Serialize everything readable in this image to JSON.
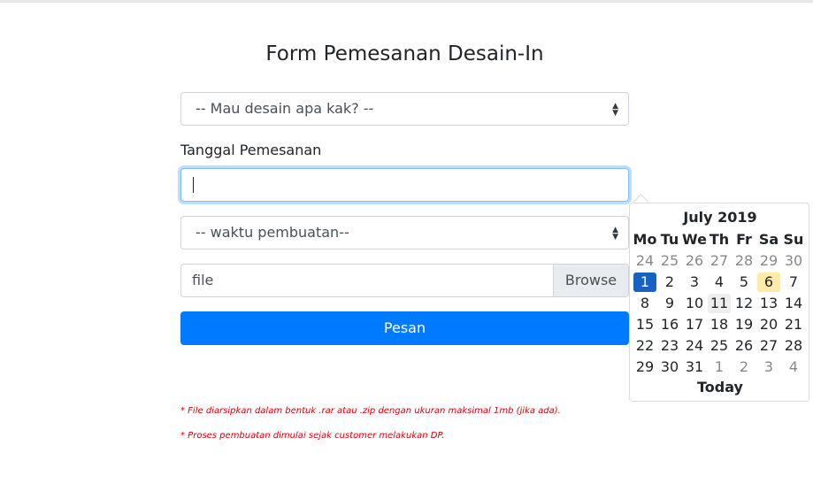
{
  "page": {
    "title": "Form Pemesanan Desain-In"
  },
  "form": {
    "design_select": "-- Mau desain apa kak? --",
    "date_label": "Tanggal Pemesanan",
    "date_value": "",
    "time_select": "-- waktu pembuatan--",
    "file_label": "file",
    "browse_label": "Browse",
    "submit_label": "Pesan"
  },
  "notes": [
    "* File diarsipkan dalam bentuk .rar atau .zip dengan ukuran maksimal 1mb (jika ada).",
    "* Proses pembuatan dimulai sejak customer melakukan DP."
  ],
  "calendar": {
    "month_year": "July 2019",
    "weekdays": [
      "Mo",
      "Tu",
      "We",
      "Th",
      "Fr",
      "Sa",
      "Su"
    ],
    "weeks": [
      [
        "24",
        "25",
        "26",
        "27",
        "28",
        "29",
        "30"
      ],
      [
        "1",
        "2",
        "3",
        "4",
        "5",
        "6",
        "7"
      ],
      [
        "8",
        "9",
        "10",
        "11",
        "12",
        "13",
        "14"
      ],
      [
        "15",
        "16",
        "17",
        "18",
        "19",
        "20",
        "21"
      ],
      [
        "22",
        "23",
        "24",
        "25",
        "26",
        "27",
        "28"
      ],
      [
        "29",
        "30",
        "31",
        "1",
        "2",
        "3",
        "4"
      ]
    ],
    "today_label": "Today",
    "selected_day": "1",
    "highlighted_day": "6",
    "hovered_day": "11"
  },
  "colors": {
    "primary": "#007bff",
    "note_red": "#dc0000",
    "today": "#1565c0",
    "highlight": "#ffeaa7"
  }
}
